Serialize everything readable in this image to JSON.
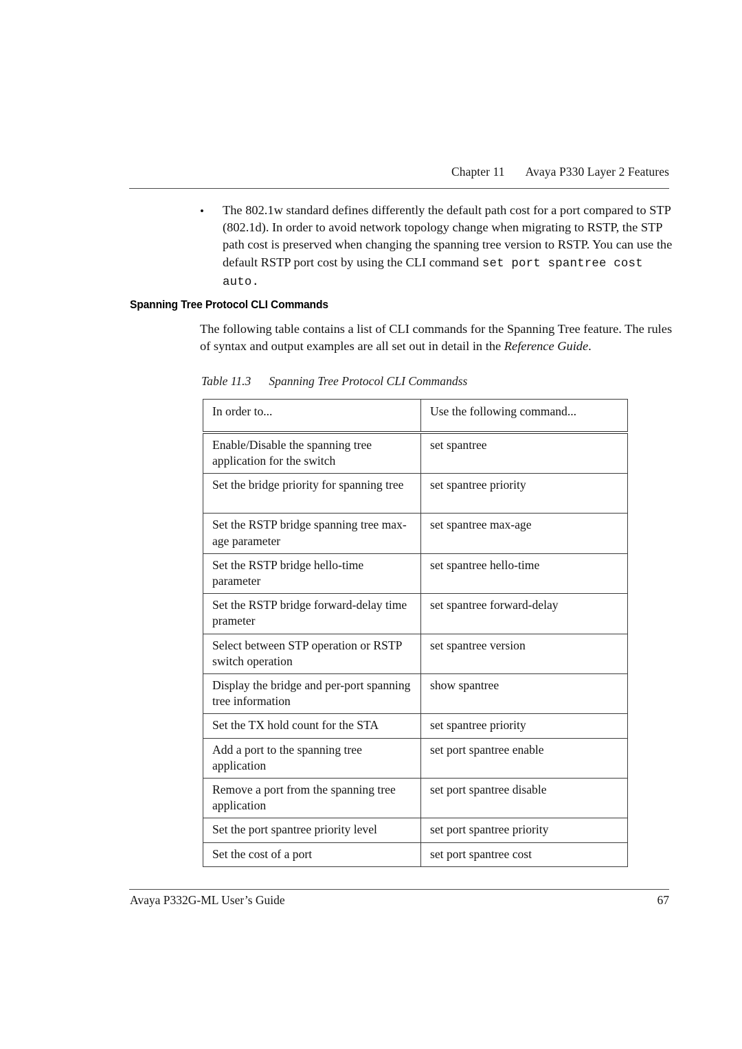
{
  "header": {
    "chapter": "Chapter 11",
    "title": "Avaya P330 Layer 2 Features"
  },
  "bullet": {
    "marker": "•",
    "text_before_command": "The 802.1w standard defines differently the default path cost for a port compared to STP (802.1d). In order to avoid network topology change when migrating to RSTP, the STP path cost is preserved when changing the spanning tree version to RSTP. You can use the default RSTP port cost by using the CLI command ",
    "command": "set port spantree cost auto."
  },
  "section": {
    "heading": "Spanning Tree Protocol CLI Commands",
    "intro_part1": "The following table contains a list of CLI commands for the Spanning Tree feature. The  rules of syntax and output examples are all set out in detail in the ",
    "intro_italic": "Reference Guide",
    "intro_part2": "."
  },
  "table": {
    "caption_number": "Table 11.3",
    "caption_title": "Spanning Tree Protocol CLI Commandss",
    "columns": [
      "In order to...",
      "Use the following command..."
    ],
    "rows": [
      {
        "action": "Enable/Disable the spanning tree application for the switch",
        "command": "set spantree",
        "lines": 2
      },
      {
        "action": "Set the bridge priority for spanning tree",
        "command": "set spantree priority",
        "lines": 2
      },
      {
        "action": "Set the RSTP bridge spanning tree max-age parameter",
        "command": "set spantree max-age",
        "lines": 2
      },
      {
        "action": "Set the RSTP bridge hello-time parameter",
        "command": "set spantree hello-time",
        "lines": 2
      },
      {
        "action": "Set the RSTP bridge forward-delay time prameter",
        "command": "set spantree forward-delay",
        "lines": 2
      },
      {
        "action": "Select between STP operation or RSTP switch operation",
        "command": "set spantree version",
        "lines": 2
      },
      {
        "action": "Display the bridge and per-port spanning tree information",
        "command": "show spantree",
        "lines": 2
      },
      {
        "action": "Set the TX hold count for the STA",
        "command": "set spantree priority",
        "lines": 1
      },
      {
        "action": "Add a port to the spanning tree application",
        "command": "set port spantree enable",
        "lines": 2
      },
      {
        "action": "Remove a port from the spanning tree application",
        "command": "set port spantree disable",
        "lines": 2
      },
      {
        "action": "Set the port spantree priority level",
        "command": "set port spantree priority",
        "lines": 1
      },
      {
        "action": "Set the cost of a port",
        "command": "set port spantree cost",
        "lines": 1
      }
    ]
  },
  "footer": {
    "document_title": "Avaya P332G-ML User’s Guide",
    "page_number": "67"
  }
}
